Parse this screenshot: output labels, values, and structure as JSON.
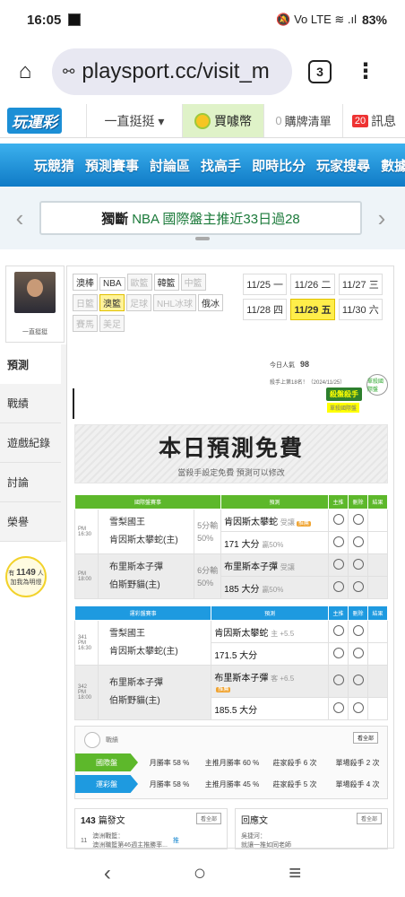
{
  "status": {
    "time": "16:05",
    "battery": "83%",
    "icons": "🔕 Vo LTE ≋ .ıl"
  },
  "browser": {
    "home_icon": "⌂",
    "tune_icon": "⚯",
    "url": "playsport.cc/visit_m",
    "tab_count": "3",
    "menu_icon": "⋮"
  },
  "site": {
    "logo": "玩運彩",
    "dropdown": "一直挺挺 ▾",
    "buy": "買噱幣",
    "cart_count": "0",
    "cart": "購牌清單",
    "msg_count": "20",
    "msg": "訊息"
  },
  "nav": [
    "玩競猜",
    "預測賽事",
    "討論區",
    "找高手",
    "即時比分",
    "玩家搜尋",
    "數據"
  ],
  "marquee": {
    "prefix": "獨斷",
    "text": "NBA 國際盤主推近33日過28",
    "left": "‹",
    "right": "›"
  },
  "profile": {
    "name": "一直挺挺"
  },
  "sidebar": [
    "預測",
    "戰績",
    "遊戲紀錄",
    "討論",
    "榮譽"
  ],
  "fans": {
    "prefix": "有",
    "count": "1149",
    "suffix": "人",
    "line2": "加我為明燈"
  },
  "categories": [
    {
      "label": "澳棒",
      "style": "normal"
    },
    {
      "label": "NBA",
      "style": "normal"
    },
    {
      "label": "歐籃",
      "style": "dim"
    },
    {
      "label": "韓籃",
      "style": "normal"
    },
    {
      "label": "中籃",
      "style": "dim"
    },
    {
      "label": "日籃",
      "style": "dim"
    },
    {
      "label": "澳籃",
      "style": "yel"
    },
    {
      "label": "足球",
      "style": "dim"
    },
    {
      "label": "NHL冰球",
      "style": "dim"
    },
    {
      "label": "俄冰",
      "style": "normal"
    },
    {
      "label": "賽馬",
      "style": "dim"
    },
    {
      "label": "美足",
      "style": "dim"
    }
  ],
  "dates": [
    {
      "label": "11/25 一",
      "sel": false
    },
    {
      "label": "11/26 二",
      "sel": false
    },
    {
      "label": "11/27 三",
      "sel": false
    },
    {
      "label": "11/28 四",
      "sel": false
    },
    {
      "label": "11/29 五",
      "sel": true
    },
    {
      "label": "11/30 六",
      "sel": false
    }
  ],
  "visits": {
    "label": "今日人氣",
    "value": "98",
    "rank": "殺手上第18名！（2024/11/25）"
  },
  "mascot": {
    "bubble": "殺盤殺手",
    "badge": "單殺國際盤",
    "sub": "單殺國際盤"
  },
  "banner": {
    "title": "本日預測免費",
    "sub": "當殺手設定免費 預測可以修改"
  },
  "intl": {
    "header": [
      "國際盤賽事",
      "預測",
      "主推",
      "刪除",
      "結果"
    ],
    "games": [
      {
        "time": "PM 16:30",
        "team1": "雪梨國王",
        "team2": "肯因斯太攀蛇(主)",
        "odds": "5分輸 50%",
        "pick1": "肯因斯太攀蛇",
        "pick1_note": "受讓",
        "pick1_hot": "推薦",
        "pick2": "171 大分",
        "pick2_note": "贏50%"
      },
      {
        "time": "PM 18:00",
        "team1": "布里斯本子彈",
        "team2": "伯斯野貓(主)",
        "odds": "6分輸 50%",
        "pick1": "布里斯本子彈",
        "pick1_note": "受讓",
        "pick1_hot": "",
        "pick2": "185 大分",
        "pick2_note": "贏50%"
      }
    ]
  },
  "local": {
    "header": [
      "運彩盤賽事",
      "預測",
      "主推",
      "刪除",
      "結果"
    ],
    "games": [
      {
        "num": "341",
        "time": "PM 16:30",
        "team1": "雪梨國王",
        "team2": "肯因斯太攀蛇(主)",
        "pick1": "肯因斯太攀蛇",
        "pick1_note": "主 +5.5",
        "pick2": "171.5 大分"
      },
      {
        "num": "342",
        "time": "PM 18:00",
        "team1": "布里斯本子彈",
        "team2": "伯斯野貓(主)",
        "pick1": "布里斯本子彈",
        "pick1_note": "客 +6.5",
        "pick1_hot": "推薦",
        "pick2": "185.5 大分"
      }
    ]
  },
  "stats": {
    "title": "戰績",
    "more": "看全部",
    "rows": [
      {
        "label": "國際盤",
        "color": "#5db82b",
        "cells": [
          "月勝率 58 %",
          "主推月勝率 60 %",
          "莊家殺手 6 次",
          "單場殺手 2 次"
        ]
      },
      {
        "label": "運彩盤",
        "color": "#1e9ae0",
        "cells": [
          "月勝率 58 %",
          "主推月勝率 45 %",
          "莊家殺手 5 次",
          "單場殺手 4 次"
        ]
      }
    ]
  },
  "posts": {
    "count": "143",
    "label": "篇發文",
    "more": "看全部",
    "item_num": "11",
    "item_title": "澳洲戰籃：",
    "item_line2": "澳洲職籃第46週主推勝率...",
    "item_badge": "推"
  },
  "replies": {
    "label": "回應文",
    "more": "看全部",
    "item_title": "吳捷河：",
    "item_line2": "就讓一推如同老師"
  },
  "bottom_nav": [
    "‹",
    "○",
    "≡"
  ]
}
